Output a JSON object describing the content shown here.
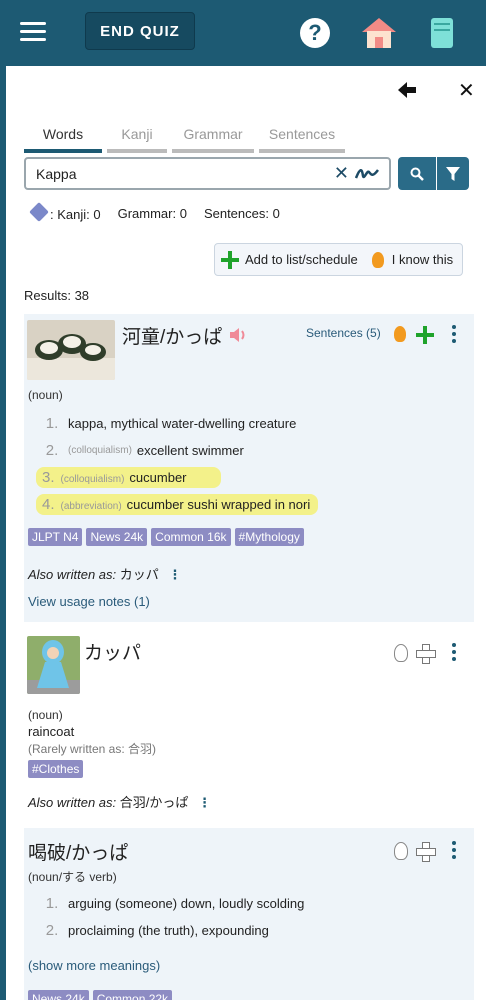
{
  "topbar": {
    "end_quiz": "END QUIZ",
    "help": "?"
  },
  "tabs": [
    "Words",
    "Kanji",
    "Grammar",
    "Sentences"
  ],
  "search": {
    "value": "Kappa"
  },
  "counts": {
    "kanji": ": Kanji: 0",
    "grammar": "Grammar: 0",
    "sentences": "Sentences: 0"
  },
  "actions": {
    "add": "Add to list/schedule",
    "know": "I know this"
  },
  "results": "Results: 38",
  "entries": [
    {
      "word": "河童/かっぱ",
      "sentences": "Sentences (5)",
      "pos": "(noun)",
      "meanings": [
        {
          "num": "1.",
          "tag": "",
          "text": "kappa, mythical water-dwelling creature"
        },
        {
          "num": "2.",
          "tag": "(colloquialism)",
          "text": "excellent swimmer"
        },
        {
          "num": "3.",
          "tag": "(colloquialism)",
          "text": "cucumber"
        },
        {
          "num": "4.",
          "tag": "(abbreviation)",
          "text": "cucumber sushi wrapped in nori"
        }
      ],
      "badges": [
        "JLPT N4",
        "News 24k",
        "Common 16k",
        "#Mythology"
      ],
      "also_label": "Also written as:",
      "also_value": "カッパ",
      "usage": "View usage notes (1)"
    },
    {
      "word": "カッパ",
      "pos": "(noun)",
      "meaning": "raincoat",
      "rarely": "(Rarely written as: 合羽)",
      "badges": [
        "#Clothes"
      ],
      "also_label": "Also written as:",
      "also_value": "合羽/かっぱ"
    },
    {
      "word": "喝破/かっぱ",
      "pos": "(noun/する verb)",
      "meanings": [
        {
          "num": "1.",
          "text": "arguing (someone) down, loudly scolding"
        },
        {
          "num": "2.",
          "text": "proclaiming (the truth), expounding"
        }
      ],
      "more": "(show more meanings)",
      "badges": [
        "News 24k",
        "Common 22k"
      ]
    }
  ]
}
